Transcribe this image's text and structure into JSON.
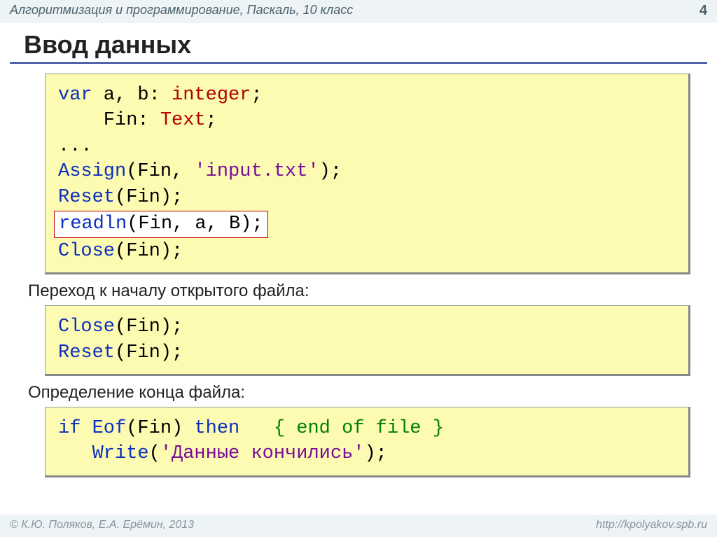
{
  "header": {
    "breadcrumb": "Алгоритмизация и программирование, Паскаль, 10 класс",
    "page": "4"
  },
  "title": "Ввод данных",
  "code1": {
    "l1_var": "var",
    "l1_rest": " a, b: ",
    "l1_type": "integer",
    "l1_end": ";",
    "l2_pad": "    Fin: ",
    "l2_type": "Text",
    "l2_end": ";",
    "l3": "...",
    "l4_fn": "Assign",
    "l4_args_a": "(Fin, ",
    "l4_str": "'input.txt'",
    "l4_args_b": ");",
    "l5_fn": "Reset",
    "l5_args": "(Fin);",
    "l6_fn": "readln",
    "l6_args": "(Fin, a, B);",
    "l7_fn": "Close",
    "l7_args": "(Fin);"
  },
  "caption1": "Переход к началу открытого файла:",
  "code2": {
    "l1_fn": "Close",
    "l1_args": "(Fin);",
    "l2_fn": "Reset",
    "l2_args": "(Fin);"
  },
  "caption2": "Определение конца файла:",
  "code3": {
    "l1_if": "if",
    "l1_eof": " Eof",
    "l1_mid": "(Fin) ",
    "l1_then": "then",
    "l1_sp": "   ",
    "l1_com": "{ end of file }",
    "l2_pad": "   ",
    "l2_fn": "Write",
    "l2_open": "(",
    "l2_str": "'Данные кончились'",
    "l2_close": ");"
  },
  "footer": {
    "left": "© К.Ю. Поляков, Е.А. Ерёмин, 2013",
    "right": "http://kpolyakov.spb.ru"
  }
}
